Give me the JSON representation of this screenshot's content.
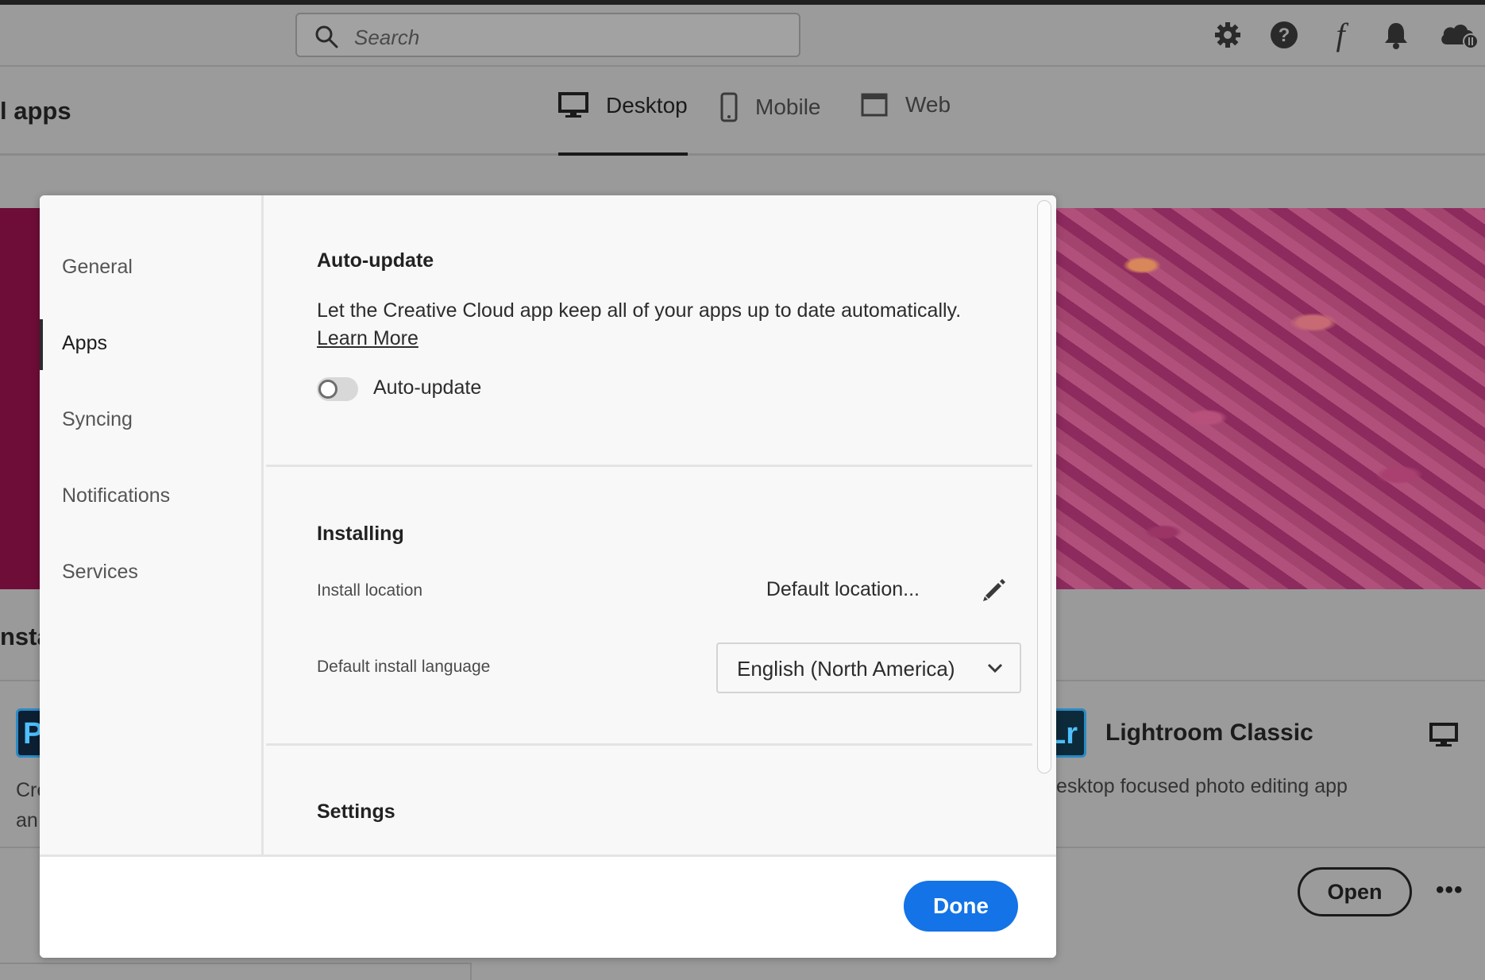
{
  "app": {
    "search_placeholder": "Search",
    "header_icons": [
      "gear-icon",
      "help-icon",
      "fonts-icon",
      "bell-icon",
      "cloud-icon"
    ],
    "fonts_glyph": "f",
    "page_title": "l apps",
    "nav_tabs": [
      {
        "label": "Desktop",
        "icon": "desktop-icon",
        "active": true
      },
      {
        "label": "Mobile",
        "icon": "mobile-icon",
        "active": false
      },
      {
        "label": "Web",
        "icon": "web-icon",
        "active": false
      }
    ],
    "installed_label": "nsta",
    "apps": [
      {
        "icon_text": "P",
        "description": "Cre\nan"
      },
      {
        "icon_text": "Lr",
        "name": "Lightroom Classic",
        "description": "esktop focused photo editing app",
        "action": "Open",
        "more": "•••"
      }
    ]
  },
  "dialog": {
    "nav": [
      {
        "label": "General",
        "active": false
      },
      {
        "label": "Apps",
        "active": true
      },
      {
        "label": "Syncing",
        "active": false
      },
      {
        "label": "Notifications",
        "active": false
      },
      {
        "label": "Services",
        "active": false
      }
    ],
    "auto_update": {
      "title": "Auto-update",
      "description": "Let the Creative Cloud app keep all of your apps up to date automatically.",
      "learn_more": "Learn More",
      "toggle_label": "Auto-update",
      "toggle_on": false
    },
    "installing": {
      "title": "Installing",
      "location_label": "Install location",
      "location_value": "Default location...",
      "language_label": "Default install language",
      "language_value": "English (North America)"
    },
    "settings_title": "Settings",
    "done_label": "Done"
  },
  "colors": {
    "accent": "#1473e6",
    "hero_magenta": "#6e0d38"
  }
}
